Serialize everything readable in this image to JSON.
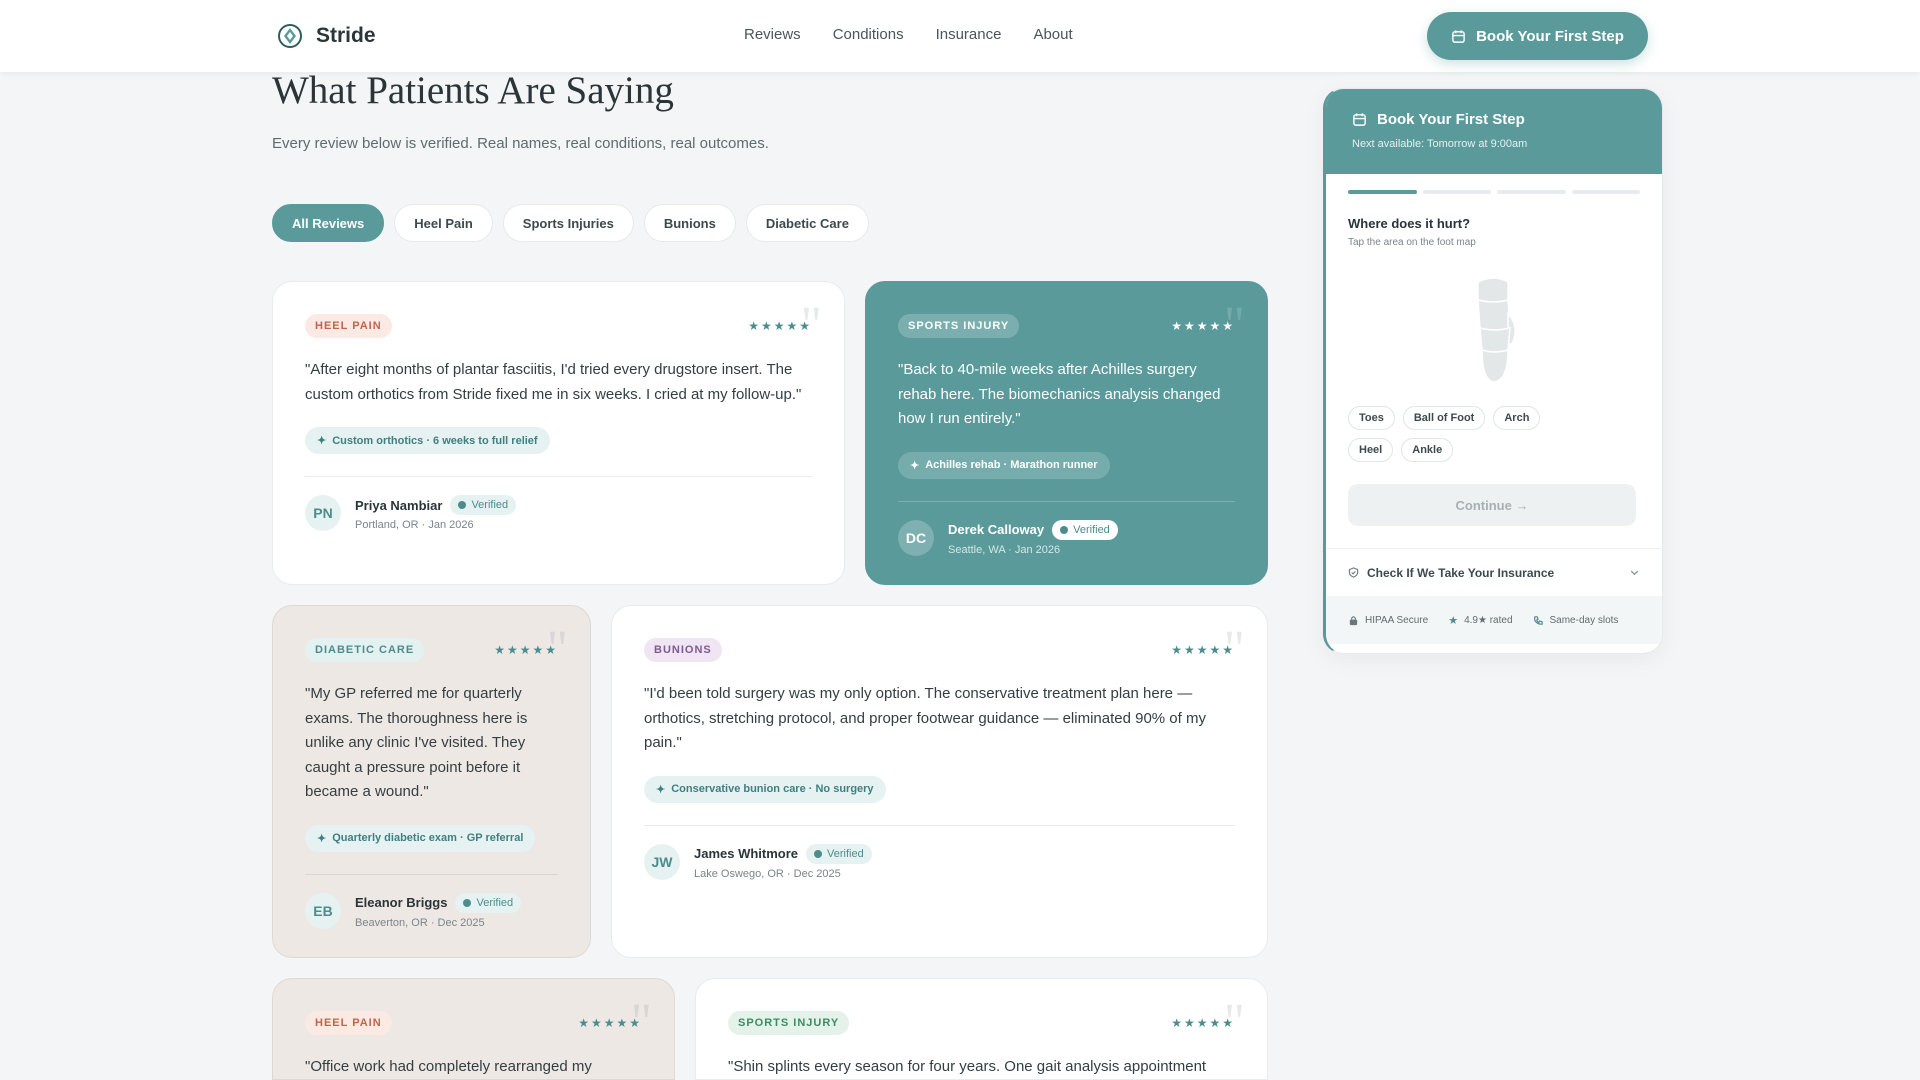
{
  "header": {
    "brand": "Stride",
    "nav": [
      "Reviews",
      "Conditions",
      "Insurance",
      "About"
    ],
    "cta_label": "Book Your First Step"
  },
  "page": {
    "title": "What Patients Are Saying",
    "subtitle": "Every review below is verified. Real names, real conditions, real outcomes."
  },
  "filters": [
    "All Reviews",
    "Heel Pain",
    "Sports Injuries",
    "Bunions",
    "Diabetic Care"
  ],
  "active_filter": "All Reviews",
  "reviews": [
    {
      "tag": "HEEL PAIN",
      "rating": 5,
      "stars": "★★★★★",
      "quote": "\"After eight months of plantar fasciitis, I'd tried every drugstore insert. The custom orthotics from Stride fixed me in six weeks. I cried at my follow-up.\"",
      "outcome": "Custom orthotics · 6 weeks to full relief",
      "initials": "PN",
      "name": "Priya Nambiar",
      "verified": "Verified",
      "meta": "Portland, OR · Jan 2026"
    },
    {
      "tag": "SPORTS INJURY",
      "rating": 5,
      "stars": "★★★★★",
      "quote": "\"Back to 40-mile weeks after Achilles surgery rehab here. The biomechanics analysis changed how I run entirely.\"",
      "outcome": "Achilles rehab · Marathon runner",
      "initials": "DC",
      "name": "Derek Calloway",
      "verified": "Verified",
      "meta": "Seattle, WA · Jan 2026"
    },
    {
      "tag": "DIABETIC CARE",
      "rating": 5,
      "stars": "★★★★★",
      "quote": "\"My GP referred me for quarterly exams. The thoroughness here is unlike any clinic I've visited. They caught a pressure point before it became a wound.\"",
      "outcome": "Quarterly diabetic exam · GP referral",
      "initials": "EB",
      "name": "Eleanor Briggs",
      "verified": "Verified",
      "meta": "Beaverton, OR · Dec 2025"
    },
    {
      "tag": "BUNIONS",
      "rating": 5,
      "stars": "★★★★★",
      "quote": "\"I'd been told surgery was my only option. The conservative treatment plan here — orthotics, stretching protocol, and proper footwear guidance — eliminated 90% of my pain.\"",
      "outcome": "Conservative bunion care · No surgery",
      "initials": "JW",
      "name": "James Whitmore",
      "verified": "Verified",
      "meta": "Lake Oswego, OR · Dec 2025"
    },
    {
      "tag": "HEEL PAIN",
      "rating": 5,
      "stars": "★★★★★",
      "quote": "\"Office work had completely rearranged my"
    },
    {
      "tag": "SPORTS INJURY",
      "rating": 5,
      "stars": "★★★★★",
      "quote": "\"Shin splints every season for four years. One gait analysis appointment"
    }
  ],
  "booking": {
    "title": "Book Your First Step",
    "next_available": "Next available: Tomorrow at 9:00am",
    "steps_total": 4,
    "current_step": 1,
    "question": "Where does it hurt?",
    "hint": "Tap the area on the foot map",
    "areas": [
      "Toes",
      "Ball of Foot",
      "Arch",
      "Heel",
      "Ankle"
    ],
    "continue_label": "Continue →",
    "insurance_label": "Check If We Take Your Insurance",
    "trust": [
      "HIPAA Secure",
      "4.9★ rated",
      "Same-day slots"
    ]
  },
  "colors": {
    "accent": "#5a9a9b",
    "background": "#f3f5f6",
    "sand_card": "#ede8e4",
    "heel_tag": "#c0654a",
    "bunions_tag": "#7d5a93",
    "sports_tag": "#3f8a62"
  },
  "icons": [
    "logo-mark",
    "calendar-icon",
    "sparkle-icon",
    "verified-dot-icon",
    "shield-icon",
    "chevron-down-icon",
    "lock-icon",
    "star-icon",
    "phone-icon",
    "foot-map",
    "quote-mark-icon"
  ]
}
